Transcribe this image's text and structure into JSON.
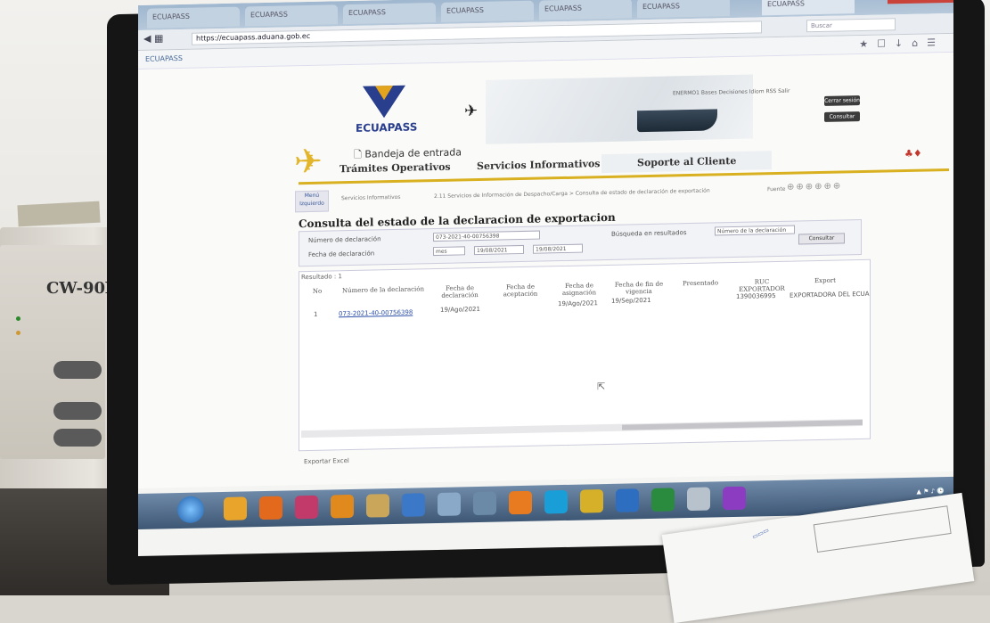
{
  "browser": {
    "tabs": [
      "ECUAPASS",
      "ECUAPASS",
      "ECUAPASS",
      "ECUAPASS",
      "ECUAPASS",
      "ECUAPASS",
      "ECUAPASS"
    ],
    "url": "https://ecuapass.aduana.gob.ec",
    "search_placeholder": "Buscar",
    "bookmark": "ECUAPASS"
  },
  "header": {
    "logo_text": "ECUAPASS",
    "inbox_label": "Bandeja de entrada",
    "top_links": "ENERMO1  Bases Decisiones  Idiom  RSS  Salir",
    "cerrar_label": "Cerrar sesión",
    "buscar_label": "Consultar"
  },
  "menu": {
    "items": [
      "Trámites Operativos",
      "Servicios Informativos",
      "Soporte al Cliente"
    ]
  },
  "breadcrumb": {
    "menu_izq": "Menú Izquierdo",
    "c1": "Servicios Informativos",
    "c2": "2.11 Servicios de Información de Despacho/Carga > Consulta de estado de declaración de exportación",
    "fuente": "Fuente"
  },
  "form": {
    "title": "Consulta del estado de la declaracion de exportacion",
    "num_label": "Número de declaración",
    "num_value": "073-2021-40-00756398",
    "fecha_label": "Fecha de declaración",
    "fecha_select": "mes",
    "fecha_from": "19/08/2021",
    "fecha_to": "19/08/2021",
    "busqueda_label": "Búsqueda en resultados",
    "busqueda_select": "Número de la declaración",
    "consultar": "Consultar"
  },
  "results": {
    "title": "Resultado : 1",
    "columns": [
      "No",
      "Número de la declaración",
      "Fecha de declaración",
      "Fecha de aceptación",
      "Fecha de asignación",
      "Fecha de fin de vigencia",
      "Presentado",
      "RUC EXPORTADOR",
      "Export"
    ],
    "rows": [
      {
        "no": "1",
        "numero": "073-2021-40-00756398",
        "fecha_decl": "19/Ago/2021",
        "fecha_acep": "",
        "fecha_asig": "19/Ago/2021",
        "fecha_fin": "19/Sep/2021",
        "ruc": "1390036995",
        "exportador": "EXPORTADORA DEL ECUA"
      }
    ],
    "excel_label": "Exportar Excel"
  },
  "colors": {
    "brand_blue": "#2a3e8e",
    "brand_gold": "#d9b01f",
    "link": "#2c4ea8"
  }
}
